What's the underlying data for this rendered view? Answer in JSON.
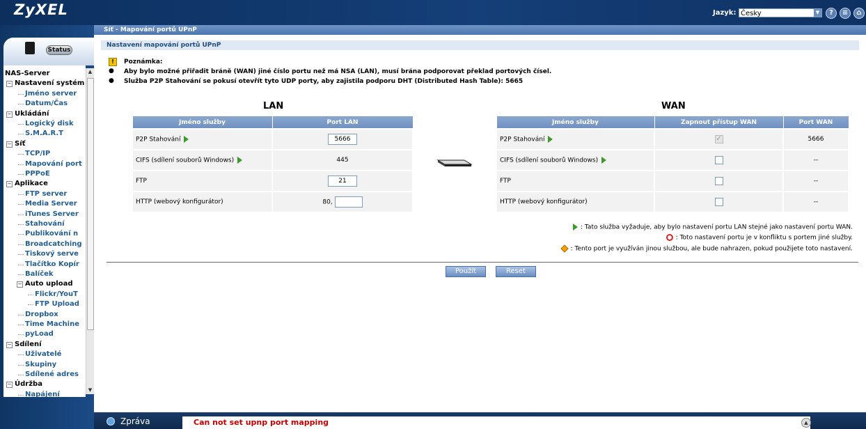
{
  "header": {
    "logo": "ZyXEL",
    "language_label": "Jazyk:",
    "language_selected": "Česky",
    "help_icon": "question-icon",
    "doc_icon": "document-icon",
    "home_icon": "home-icon"
  },
  "sidebar": {
    "status_label": "Status",
    "tree": [
      {
        "label": "NAS-Server",
        "level": 0,
        "expanded": true
      },
      {
        "label": "Nastavení systém",
        "level": 1,
        "expanded": true
      },
      {
        "label": "Jméno server",
        "level": 2
      },
      {
        "label": "Datum/Čas",
        "level": 2
      },
      {
        "label": "Ukládání",
        "level": 1,
        "expanded": true
      },
      {
        "label": "Logický disk",
        "level": 2
      },
      {
        "label": "S.M.A.R.T",
        "level": 2
      },
      {
        "label": "Síť",
        "level": 1,
        "expanded": true
      },
      {
        "label": "TCP/IP",
        "level": 2
      },
      {
        "label": "Mapování port",
        "level": 2
      },
      {
        "label": "PPPoE",
        "level": 2
      },
      {
        "label": "Aplikace",
        "level": 1,
        "expanded": true
      },
      {
        "label": "FTP server",
        "level": 2
      },
      {
        "label": "Media Server",
        "level": 2
      },
      {
        "label": "iTunes Server",
        "level": 2
      },
      {
        "label": "Stahování",
        "level": 2
      },
      {
        "label": "Publikování n",
        "level": 2
      },
      {
        "label": "Broadcatching",
        "level": 2
      },
      {
        "label": "Tiskový serve",
        "level": 2
      },
      {
        "label": "Tlačítko Kopír",
        "level": 2
      },
      {
        "label": "Balíček",
        "level": 2
      },
      {
        "label": "Auto upload",
        "level": 2,
        "expanded": true
      },
      {
        "label": "Flickr/YouT",
        "level": 3
      },
      {
        "label": "FTP Upload",
        "level": 3
      },
      {
        "label": "Dropbox",
        "level": 2
      },
      {
        "label": "Time Machine",
        "level": 2
      },
      {
        "label": "pyLoad",
        "level": 2
      },
      {
        "label": "Sdílení",
        "level": 1,
        "expanded": true
      },
      {
        "label": "Uživatelé",
        "level": 2
      },
      {
        "label": "Skupiny",
        "level": 2
      },
      {
        "label": "Sdílené adres",
        "level": 2
      },
      {
        "label": "Údržba",
        "level": 1,
        "expanded": true
      },
      {
        "label": "Napájení",
        "level": 2
      }
    ]
  },
  "breadcrumb": "Síť - Mapování portů UPnP",
  "section_title": "Nastavení mapování portů UPnP",
  "note": {
    "title": "Poznámka:",
    "lines": [
      "Aby bylo možné přiřadit bráně (WAN) jiné číslo portu než má NSA (LAN), musí brána podporovat překlad portových čísel.",
      "Služba P2P Stahování se pokusí otevřít tyto UDP porty, aby zajistila podporu DHT (Distributed Hash Table): 5665"
    ]
  },
  "lan": {
    "title": "LAN",
    "headers": [
      "Jméno služby",
      "Port LAN"
    ],
    "rows": [
      {
        "service": "P2P Stahování",
        "port": "5666",
        "editable": true,
        "sync": true
      },
      {
        "service": "CIFS (sdílení souborů Windows)",
        "port": "445",
        "editable": false,
        "sync": true
      },
      {
        "service": "FTP",
        "port": "21",
        "editable": true,
        "sync": false
      },
      {
        "service": "HTTP (webový konfigurátor)",
        "port_prefix": "80,",
        "port": "",
        "editable": true,
        "sync": false
      }
    ]
  },
  "wan": {
    "title": "WAN",
    "headers": [
      "Jméno služby",
      "Zapnout přístup WAN",
      "Port WAN"
    ],
    "rows": [
      {
        "service": "P2P Stahování",
        "enabled": true,
        "disabled": true,
        "port": "5666",
        "sync": true
      },
      {
        "service": "CIFS (sdílení souborů Windows)",
        "enabled": false,
        "port": "--",
        "sync": true
      },
      {
        "service": "FTP",
        "enabled": false,
        "port": "--",
        "sync": false
      },
      {
        "service": "HTTP (webový konfigurátor)",
        "enabled": false,
        "port": "--",
        "sync": false
      }
    ]
  },
  "legend": [
    {
      "icon": "green-arrow-icon",
      "text": ": Tato služba vyžaduje, aby bylo nastavení portu LAN stejné jako nastavení portu WAN."
    },
    {
      "icon": "conflict-icon",
      "text": ": Toto nastavení portu je v konfliktu s portem jiné služby."
    },
    {
      "icon": "warning-icon",
      "text": ": Tento port je využíván jinou službou, ale bude nahrazen, pokud použijete toto nastavení."
    }
  ],
  "buttons": {
    "apply": "Použít",
    "reset": "Reset"
  },
  "message_bar": {
    "label": "Zpráva",
    "text": "Can not set upnp port mapping"
  },
  "colors": {
    "header_bg": "#153f78",
    "table_header": "#7b99c6",
    "message_text": "#c00000"
  }
}
